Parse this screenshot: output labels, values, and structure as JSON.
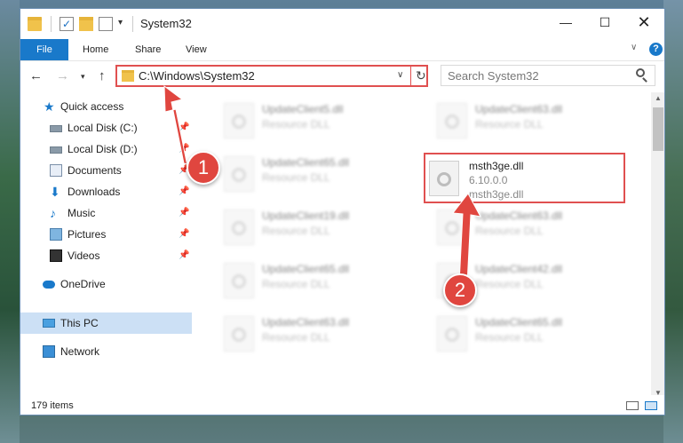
{
  "window": {
    "title": "System32"
  },
  "ribbon": {
    "file": "File",
    "home": "Home",
    "share": "Share",
    "view": "View",
    "help": "?"
  },
  "address": {
    "path": "C:\\Windows\\System32",
    "search_placeholder": "Search System32"
  },
  "nav_pane": {
    "quick_access": "Quick access",
    "items": [
      {
        "label": "Local Disk (C:)",
        "icon": "drive-icon"
      },
      {
        "label": "Local Disk (D:)",
        "icon": "drive-icon"
      },
      {
        "label": "Documents",
        "icon": "documents-icon"
      },
      {
        "label": "Downloads",
        "icon": "downloads-icon"
      },
      {
        "label": "Music",
        "icon": "music-icon"
      },
      {
        "label": "Pictures",
        "icon": "pictures-icon"
      },
      {
        "label": "Videos",
        "icon": "videos-icon"
      }
    ],
    "onedrive": "OneDrive",
    "this_pc": "This PC",
    "network": "Network"
  },
  "files": {
    "col1": [
      {
        "name": "UpdateClient5.dll",
        "desc": "Resource DLL"
      },
      {
        "name": "UpdateClient65.dll",
        "desc": "Resource DLL"
      },
      {
        "name": "UpdateClient19.dll",
        "desc": "Resource DLL"
      },
      {
        "name": "UpdateClient65.dll",
        "desc": "Resource DLL"
      },
      {
        "name": "UpdateClient63.dll",
        "desc": "Resource DLL"
      }
    ],
    "col2": [
      {
        "name": "UpdateClient63.dll",
        "desc": "Resource DLL"
      },
      {
        "name": "UpdateClient63.dll",
        "desc": "Resource DLL"
      },
      {
        "name": "UpdateClient42.dll",
        "desc": "Resource DLL"
      },
      {
        "name": "UpdateClient65.dll",
        "desc": "Resource DLL"
      }
    ],
    "selected": {
      "name": "msth3ge.dll",
      "version": "6.10.0.0",
      "desc": "msth3ge.dll"
    }
  },
  "status": {
    "item_count": "179 items"
  },
  "annotations": {
    "step1": "1",
    "step2": "2"
  },
  "colors": {
    "accent": "#1979ca",
    "annotation": "#e0463f"
  }
}
